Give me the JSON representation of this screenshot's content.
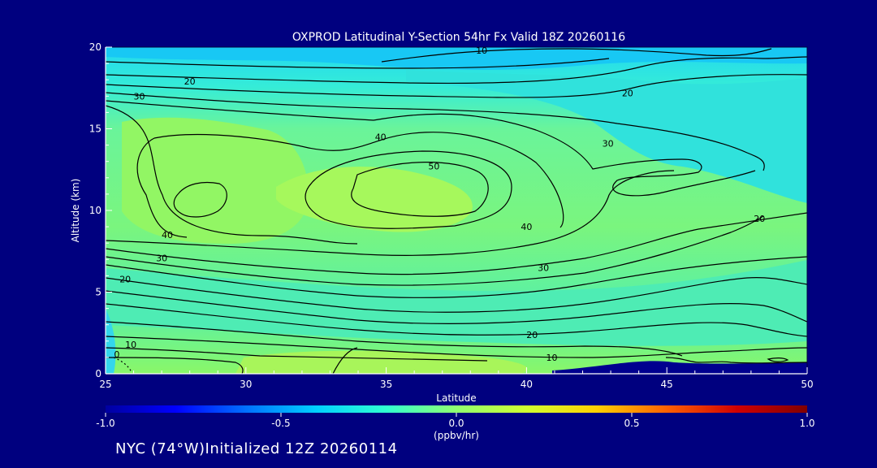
{
  "chart_data": {
    "type": "contour",
    "title": "OXPROD Latitudinal Y-Section 54hr  Fx Valid 18Z 20260116",
    "xlabel": "Latitude",
    "ylabel": "Altitude (km)",
    "xlim": [
      25,
      50
    ],
    "ylim": [
      0,
      20
    ],
    "x_ticks": [
      "25",
      "30",
      "35",
      "40",
      "45",
      "50"
    ],
    "y_ticks": [
      "0",
      "5",
      "10",
      "15",
      "20"
    ],
    "contour_labels": [
      {
        "text": "10",
        "lat": 38.4,
        "alt": 19.8
      },
      {
        "text": "20",
        "lat": 28.0,
        "alt": 17.9
      },
      {
        "text": "30",
        "lat": 26.2,
        "alt": 17.0
      },
      {
        "text": "20",
        "lat": 43.6,
        "alt": 17.2
      },
      {
        "text": "40",
        "lat": 34.8,
        "alt": 14.5
      },
      {
        "text": "30",
        "lat": 42.9,
        "alt": 14.1
      },
      {
        "text": "50",
        "lat": 36.7,
        "alt": 12.7
      },
      {
        "text": "40",
        "lat": 27.2,
        "alt": 8.5
      },
      {
        "text": "40",
        "lat": 40.0,
        "alt": 9.0
      },
      {
        "text": "20",
        "lat": 48.3,
        "alt": 9.5
      },
      {
        "text": "30",
        "lat": 27.0,
        "alt": 7.1
      },
      {
        "text": "30",
        "lat": 40.6,
        "alt": 6.5
      },
      {
        "text": "20",
        "lat": 25.7,
        "alt": 5.8
      },
      {
        "text": "20",
        "lat": 40.2,
        "alt": 2.4
      },
      {
        "text": "10",
        "lat": 25.9,
        "alt": 1.8
      },
      {
        "text": "10",
        "lat": 40.9,
        "alt": 1.0
      },
      {
        "text": "0",
        "lat": 25.4,
        "alt": 1.2
      }
    ],
    "colorbar": {
      "ticks": [
        "-1.0",
        "-0.5",
        "0.0",
        "0.5",
        "1.0"
      ],
      "range": [
        -1.0,
        1.0
      ],
      "unit": "(ppbv/hr)",
      "colors": [
        "#0000a0",
        "#0000ff",
        "#0070ff",
        "#00d0ff",
        "#30ffd0",
        "#90ff70",
        "#d0ff30",
        "#ffd000",
        "#ff6000",
        "#d00000",
        "#800000"
      ]
    },
    "colors": {
      "background": "#00007f",
      "field_mid": "#5af4a0",
      "field_high": "#a8f860",
      "field_low": "#2be6e0",
      "contour": "#000000"
    }
  },
  "footer": {
    "text": "NYC (74°W)Initialized 12Z 20260114"
  }
}
